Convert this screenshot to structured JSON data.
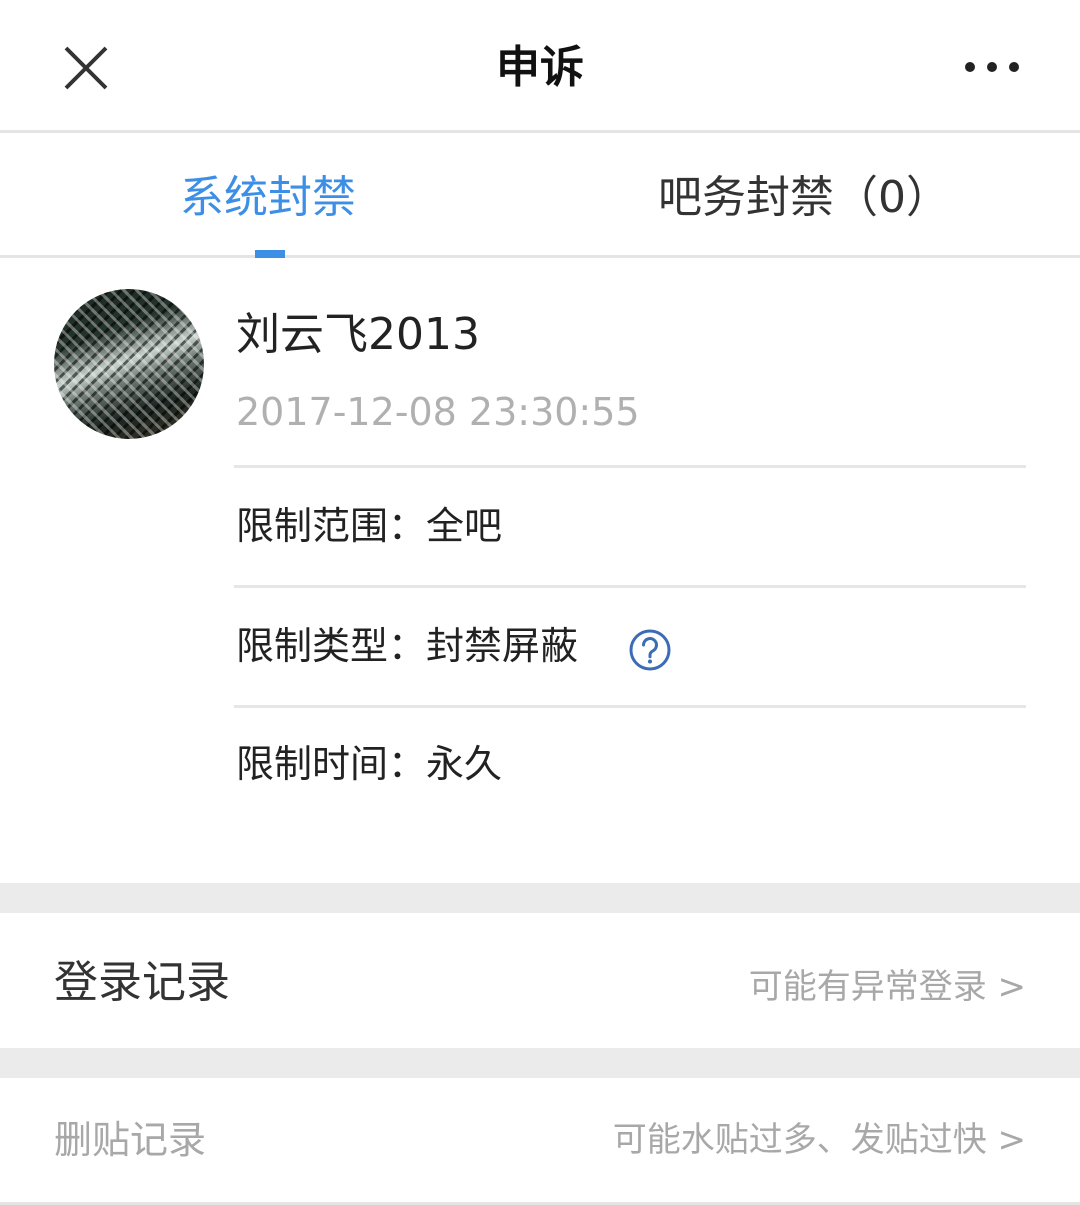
{
  "header": {
    "title": "申诉",
    "close_icon": "close-icon",
    "more_icon": "more-icon"
  },
  "tabs": [
    {
      "label": "系统封禁",
      "active": true
    },
    {
      "label": "吧务封禁（0）",
      "active": false
    }
  ],
  "record": {
    "username": "刘云飞2013",
    "datetime": "2017-12-08 23:30:55",
    "scope": "限制范围：全吧",
    "type": "限制类型：封禁屏蔽",
    "duration": "限制时间：永久"
  },
  "login_record": {
    "label": "登录记录",
    "hint": "可能有异常登录 >"
  },
  "delete_record": {
    "label": "删贴记录",
    "hint": "可能水贴过多、发贴过快 >"
  },
  "colors": {
    "accent": "#3d8fe6",
    "help_icon": "#3a6db5"
  }
}
